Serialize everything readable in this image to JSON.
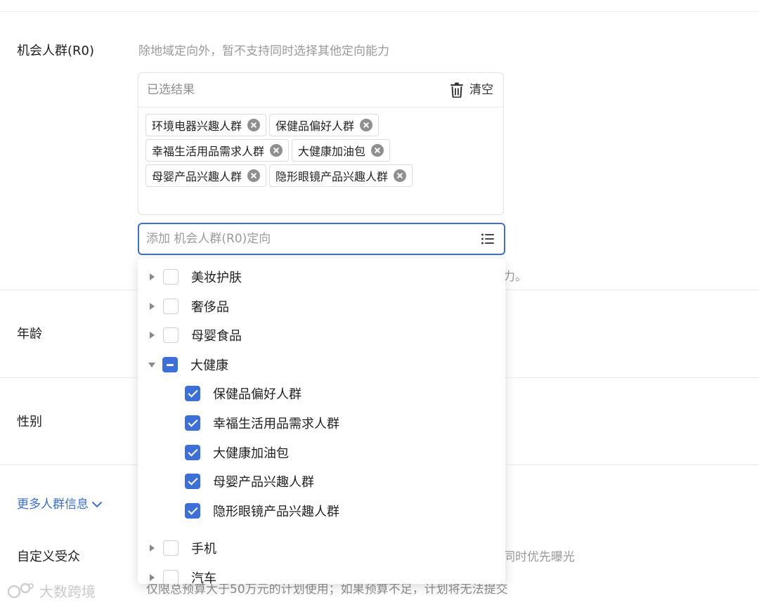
{
  "opportunity": {
    "label": "机会人群(R0)",
    "hint": "除地域定向外，暂不支持同时选择其他定向能力",
    "panel_title": "已选结果",
    "clear_label": "清空",
    "tags": [
      [
        "环境电器兴趣人群",
        "保健品偏好人群"
      ],
      [
        "幸福生活用品需求人群",
        "大健康加油包"
      ],
      [
        "母婴产品兴趣人群",
        "隐形眼镜产品兴趣人群"
      ]
    ],
    "input_placeholder": "添加 机会人群(R0)定向",
    "behind_hint_tail": "力。"
  },
  "dropdown": {
    "items": [
      {
        "label": "美妆护肤",
        "state": "unchecked",
        "expanded": false
      },
      {
        "label": "奢侈品",
        "state": "unchecked",
        "expanded": false
      },
      {
        "label": "母婴食品",
        "state": "unchecked",
        "expanded": false
      },
      {
        "label": "大健康",
        "state": "partial",
        "expanded": true
      },
      {
        "label": "保健品偏好人群",
        "state": "checked",
        "child": true
      },
      {
        "label": "幸福生活用品需求人群",
        "state": "checked",
        "child": true
      },
      {
        "label": "大健康加油包",
        "state": "checked",
        "child": true
      },
      {
        "label": "母婴产品兴趣人群",
        "state": "checked",
        "child": true
      },
      {
        "label": "隐形眼镜产品兴趣人群",
        "state": "checked",
        "child": true
      },
      {
        "label": "手机",
        "state": "unchecked",
        "expanded": false
      },
      {
        "label": "汽车",
        "state": "unchecked",
        "expanded": false
      }
    ]
  },
  "age": {
    "label": "年龄"
  },
  "gender": {
    "label": "性别"
  },
  "more_info": {
    "label": "更多人群信息"
  },
  "custom": {
    "label": "自定义受众",
    "behind_hint_tail": "同时优先曝光",
    "budget_hint": "仅限总预算大于50万元的计划使用；如果预算不足，计划将无法提交"
  },
  "watermark": {
    "text": "大数跨境"
  },
  "colors": {
    "accent": "#3d6fd9",
    "link": "#3b6fd8",
    "muted": "#9a9a9a"
  }
}
